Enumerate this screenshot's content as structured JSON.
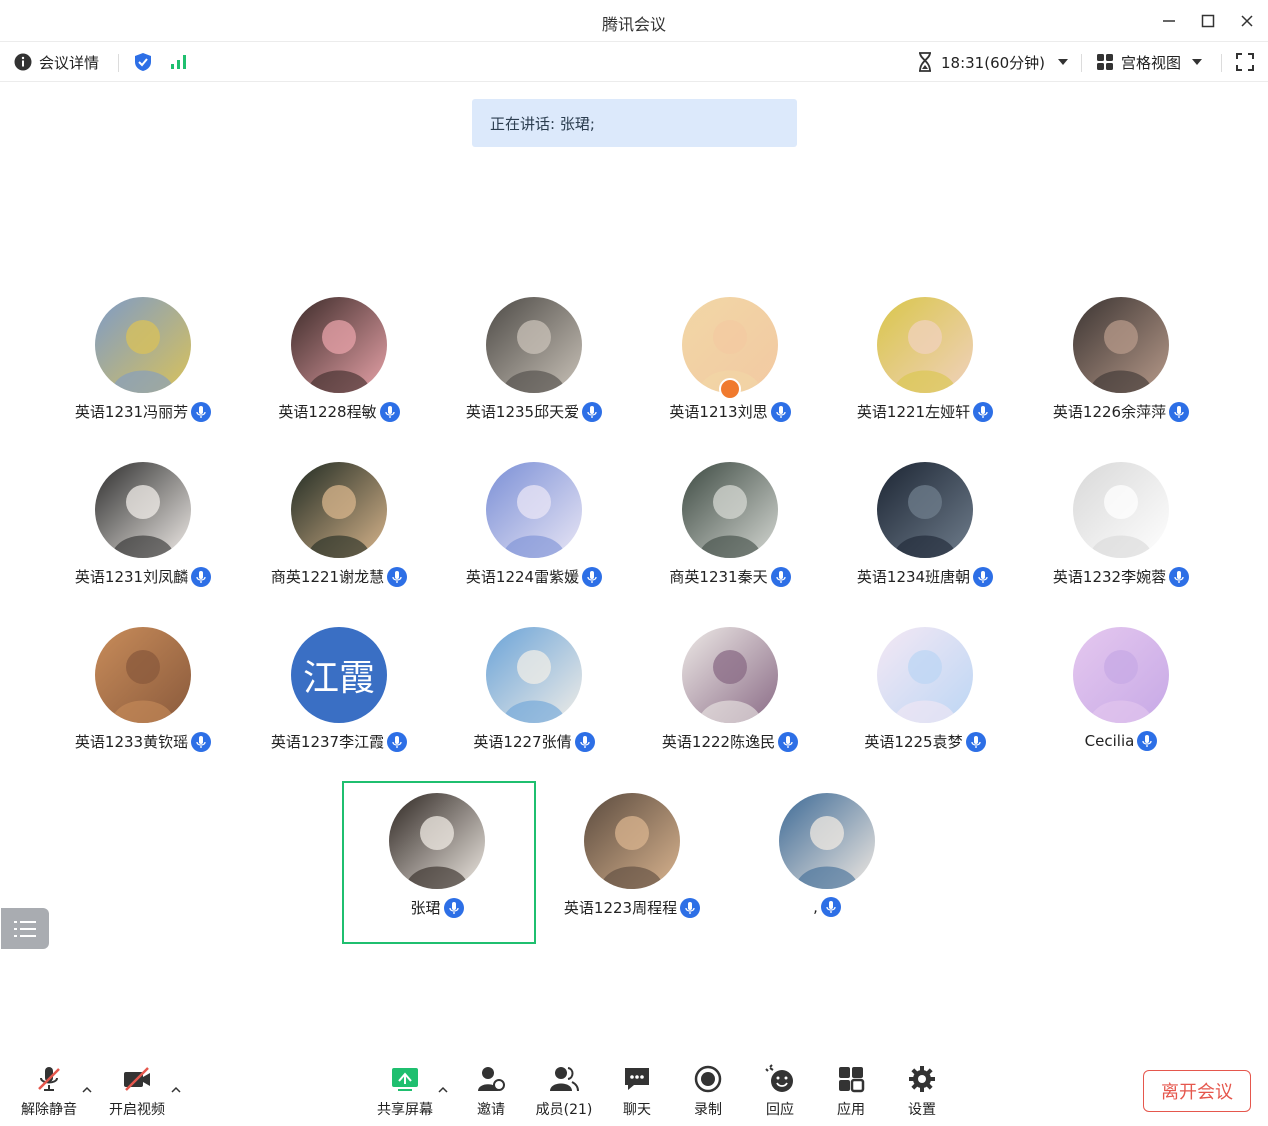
{
  "window": {
    "title": "腾讯会议"
  },
  "toolbar": {
    "details_label": "会议详情",
    "timer_label": "18:31(60分钟)",
    "view_label": "宫格视图"
  },
  "speaking": {
    "text": "正在讲话: 张珺;"
  },
  "participants": [
    {
      "name": "英语1231冯丽芳"
    },
    {
      "name": "英语1228程敏"
    },
    {
      "name": "英语1235邱天爱"
    },
    {
      "name": "英语1213刘思"
    },
    {
      "name": "英语1221左娅轩"
    },
    {
      "name": "英语1226余萍萍"
    },
    {
      "name": "英语1231刘凤麟"
    },
    {
      "name": "商英1221谢龙慧"
    },
    {
      "name": "英语1224雷紫媛"
    },
    {
      "name": "商英1231秦天"
    },
    {
      "name": "英语1234班唐朝"
    },
    {
      "name": "英语1232李婉蓉"
    },
    {
      "name": "英语1233黄钦瑶"
    },
    {
      "name": "英语1237李江霞",
      "avatar_text": "江霞"
    },
    {
      "name": "英语1227张倩"
    },
    {
      "name": "英语1222陈逸民"
    },
    {
      "name": "英语1225袁梦"
    },
    {
      "name": "Cecilia"
    },
    {
      "name": "张珺"
    },
    {
      "name": "英语1223周程程"
    },
    {
      "name": ","
    }
  ],
  "bottombar": {
    "unmute": "解除静音",
    "start_video": "开启视频",
    "share_screen": "共享屏幕",
    "invite": "邀请",
    "members": "成员(21)",
    "chat": "聊天",
    "record": "录制",
    "reactions": "回应",
    "apps": "应用",
    "settings": "设置",
    "leave": "离开会议"
  },
  "colors": {
    "accent_blue": "#2d6fe6",
    "leave_red": "#e5574d",
    "selected_green": "#1fbf6f",
    "banner_bg": "#dce9fb"
  }
}
